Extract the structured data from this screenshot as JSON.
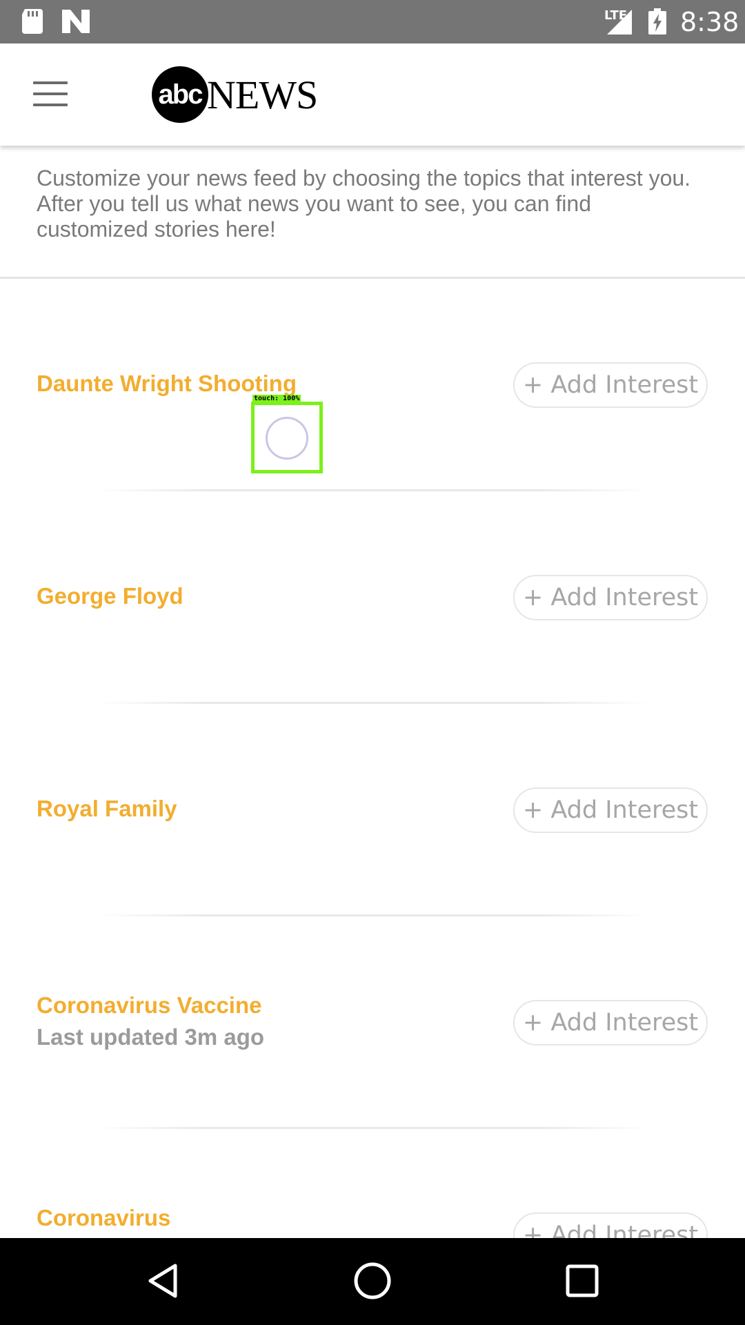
{
  "status_bar": {
    "network": "LTE",
    "time": "8:38",
    "icons": [
      "sd-card-icon",
      "n-logo-icon",
      "signal-icon",
      "battery-charging-icon"
    ]
  },
  "app_bar": {
    "logo_abc": "abc",
    "logo_news": "NEWS",
    "icons": [
      "menu-icon"
    ]
  },
  "intro_text": "Customize your news feed by choosing the topics that interest you. After you tell us what news you want to see, you can find customized stories here!",
  "topics": [
    {
      "title": "Daunte Wright Shooting",
      "subtitle": "",
      "button": "+ Add Interest"
    },
    {
      "title": "George Floyd",
      "subtitle": "",
      "button": "+ Add Interest"
    },
    {
      "title": "Royal Family",
      "subtitle": "",
      "button": "+ Add Interest"
    },
    {
      "title": "Coronavirus Vaccine",
      "subtitle": "Last updated 3m ago",
      "button": "+ Add Interest"
    },
    {
      "title": "Coronavirus",
      "subtitle": "",
      "button": "+ Add Interest"
    }
  ],
  "touch_indicator": {
    "label": "touch: 100%"
  },
  "nav_bar": {
    "icons": [
      "back-icon",
      "home-icon",
      "recents-icon"
    ]
  },
  "colors": {
    "topic_title": "#f2ad2f",
    "status_bar": "#757575",
    "touch_box": "#7cf01a"
  }
}
